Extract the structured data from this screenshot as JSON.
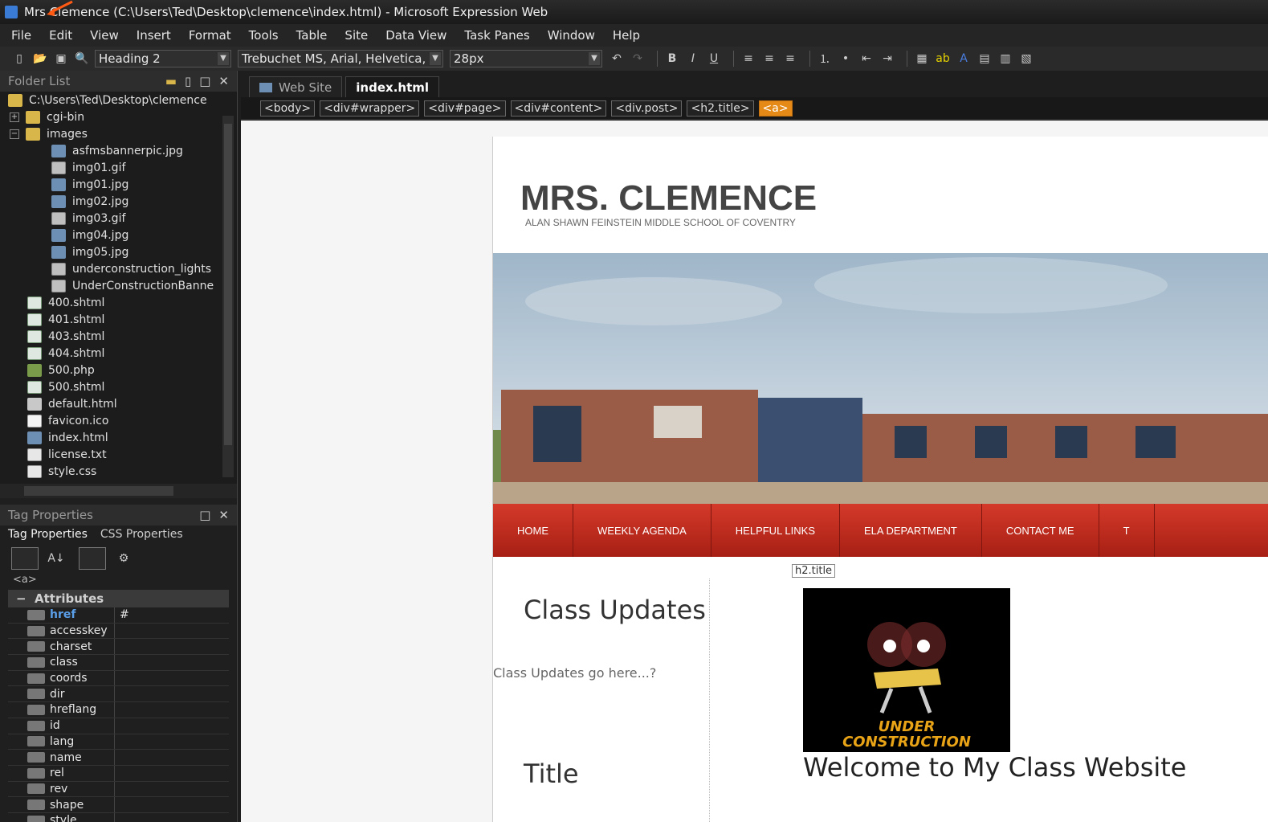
{
  "window": {
    "title": "Mrs Clemence (C:\\Users\\Ted\\Desktop\\clemence\\index.html) - Microsoft Expression Web"
  },
  "menu": [
    "File",
    "Edit",
    "View",
    "Insert",
    "Format",
    "Tools",
    "Table",
    "Site",
    "Data View",
    "Task Panes",
    "Window",
    "Help"
  ],
  "toolbar": {
    "style": "Heading 2",
    "font": "Trebuchet MS, Arial, Helvetica,",
    "size": "28px"
  },
  "folder_list": {
    "title": "Folder List",
    "root": "C:\\Users\\Ted\\Desktop\\clemence",
    "items": [
      {
        "label": "cgi-bin",
        "type": "folder",
        "indent": 1,
        "expander": "+"
      },
      {
        "label": "images",
        "type": "folder",
        "indent": 1,
        "expander": "−"
      },
      {
        "label": "asfmsbannerpic.jpg",
        "type": "img",
        "indent": 2
      },
      {
        "label": "img01.gif",
        "type": "gif",
        "indent": 2
      },
      {
        "label": "img01.jpg",
        "type": "img",
        "indent": 2
      },
      {
        "label": "img02.jpg",
        "type": "img",
        "indent": 2
      },
      {
        "label": "img03.gif",
        "type": "gif",
        "indent": 2
      },
      {
        "label": "img04.jpg",
        "type": "img",
        "indent": 2
      },
      {
        "label": "img05.jpg",
        "type": "img",
        "indent": 2
      },
      {
        "label": "underconstruction_lights",
        "type": "gif",
        "indent": 2
      },
      {
        "label": "UnderConstructionBanne",
        "type": "gif",
        "indent": 2
      },
      {
        "label": "400.shtml",
        "type": "page",
        "indent": 1
      },
      {
        "label": "401.shtml",
        "type": "page",
        "indent": 1
      },
      {
        "label": "403.shtml",
        "type": "page",
        "indent": 1
      },
      {
        "label": "404.shtml",
        "type": "page",
        "indent": 1
      },
      {
        "label": "500.php",
        "type": "php",
        "indent": 1
      },
      {
        "label": "500.shtml",
        "type": "page",
        "indent": 1
      },
      {
        "label": "default.html",
        "type": "home",
        "indent": 1
      },
      {
        "label": "favicon.ico",
        "type": "blank",
        "indent": 1
      },
      {
        "label": "index.html",
        "type": "img",
        "indent": 1
      },
      {
        "label": "license.txt",
        "type": "txt",
        "indent": 1
      },
      {
        "label": "style.css",
        "type": "txt",
        "indent": 1
      }
    ]
  },
  "tag_properties": {
    "title": "Tag Properties",
    "tabs": [
      "Tag Properties",
      "CSS Properties"
    ],
    "current_tag": "<a>",
    "section": "Attributes",
    "attributes": [
      {
        "name": "href",
        "value": "#"
      },
      {
        "name": "accesskey",
        "value": ""
      },
      {
        "name": "charset",
        "value": ""
      },
      {
        "name": "class",
        "value": ""
      },
      {
        "name": "coords",
        "value": ""
      },
      {
        "name": "dir",
        "value": ""
      },
      {
        "name": "hreflang",
        "value": ""
      },
      {
        "name": "id",
        "value": ""
      },
      {
        "name": "lang",
        "value": ""
      },
      {
        "name": "name",
        "value": ""
      },
      {
        "name": "rel",
        "value": ""
      },
      {
        "name": "rev",
        "value": ""
      },
      {
        "name": "shape",
        "value": ""
      },
      {
        "name": "style",
        "value": ""
      }
    ]
  },
  "doc_tabs": [
    "Web Site",
    "index.html"
  ],
  "breadcrumbs": [
    "<body>",
    "<div#wrapper>",
    "<div#page>",
    "<div#content>",
    "<div.post>",
    "<h2.title>",
    "<a>"
  ],
  "page": {
    "title": "MRS. CLEMENCE",
    "subtitle": "ALAN SHAWN FEINSTEIN MIDDLE SCHOOL OF COVENTRY",
    "nav": [
      "HOME",
      "WEEKLY AGENDA",
      "HELPFUL LINKS",
      "ELA DEPARTMENT",
      "CONTACT ME",
      "T"
    ],
    "h2_badge": "h2.title",
    "updates_heading": "Class Updates",
    "updates_text": "Class Updates go here...?",
    "title_heading": "Title",
    "uc_line1": "UNDER",
    "uc_line2": "CONSTRUCTION",
    "welcome": "Welcome to My Class Website"
  }
}
